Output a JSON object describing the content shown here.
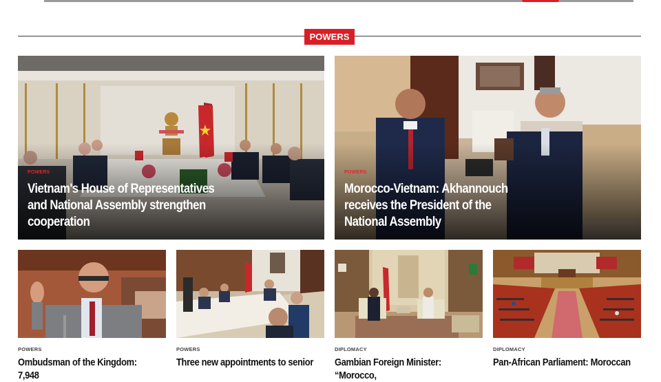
{
  "section": {
    "label": "POWERS"
  },
  "featured": [
    {
      "category": "POWERS",
      "title": "Vietnam's House of Representatives and National Assembly strengthen cooperation"
    },
    {
      "category": "POWERS",
      "title": "Morocco-Vietnam: Akhannouch receives the President of the National Assembly"
    }
  ],
  "articles": [
    {
      "category": "POWERS",
      "title": "Ombudsman of the Kingdom: 7,948"
    },
    {
      "category": "POWERS",
      "title": "Three new appointments to senior"
    },
    {
      "category": "DIPLOMACY",
      "title": "Gambian Foreign Minister: “Morocco,"
    },
    {
      "category": "DIPLOMACY",
      "title": "Pan-African Parliament: Moroccan"
    }
  ],
  "colors": {
    "accent": "#d91f26",
    "divider": "#3a3a3a"
  }
}
